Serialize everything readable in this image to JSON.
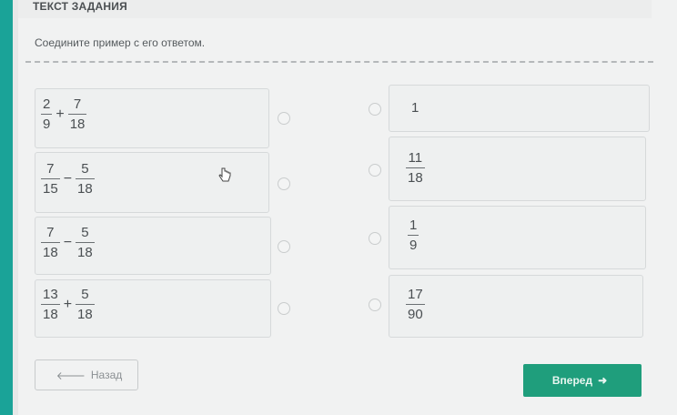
{
  "header": {
    "title": "ТЕКСТ ЗАДАНИЯ"
  },
  "task": {
    "instruction": "Соедините пример с его ответом."
  },
  "examples": [
    {
      "a_num": "2",
      "a_den": "9",
      "op": "+",
      "b_num": "7",
      "b_den": "18"
    },
    {
      "a_num": "7",
      "a_den": "15",
      "op": "−",
      "b_num": "5",
      "b_den": "18"
    },
    {
      "a_num": "7",
      "a_den": "18",
      "op": "−",
      "b_num": "5",
      "b_den": "18"
    },
    {
      "a_num": "13",
      "a_den": "18",
      "op": "+",
      "b_num": "5",
      "b_den": "18"
    }
  ],
  "answers": [
    {
      "text": "1"
    },
    {
      "num": "11",
      "den": "18"
    },
    {
      "num": "1",
      "den": "9"
    },
    {
      "num": "17",
      "den": "90"
    }
  ],
  "nav": {
    "back_label": "Назад",
    "next_label": "Вперед",
    "back_arrow": "🡐",
    "next_arrow": "➜"
  },
  "colors": {
    "accent": "#1f9e7c",
    "teal_edge": "#1aa398"
  }
}
